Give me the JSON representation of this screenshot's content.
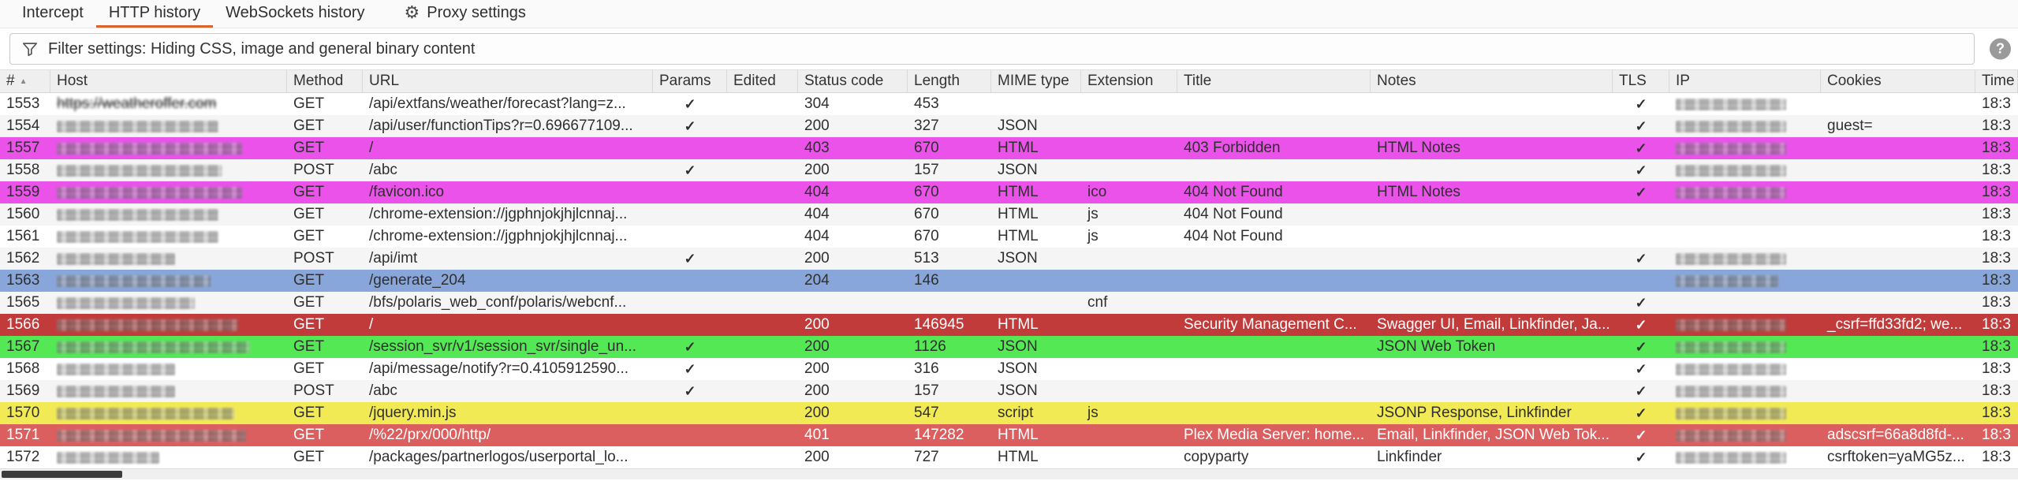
{
  "tabs": {
    "items": [
      {
        "label": "Intercept"
      },
      {
        "label": "HTTP history",
        "active": true
      },
      {
        "label": "WebSockets history"
      },
      {
        "label": "Proxy settings",
        "icon": "gear-icon"
      }
    ]
  },
  "filter_bar": {
    "icon": "filter-funnel-icon",
    "text": "Filter settings: Hiding CSS, image and general binary content",
    "help_icon": "?"
  },
  "glyphs": {
    "check": "✓",
    "sort_ascending": "▲",
    "gear": "⚙"
  },
  "colors": {
    "accent_orange": "#d9632d",
    "magenta": "#ea52ea",
    "blue": "#88a6d9",
    "green": "#55e855",
    "yellow": "#f2ea55",
    "red_dark": "#c23b3b",
    "red_light": "#dc5f5f"
  },
  "table": {
    "columns": [
      "#",
      "Host",
      "Method",
      "URL",
      "Params",
      "Edited",
      "Status code",
      "Length",
      "MIME type",
      "Extension",
      "Title",
      "Notes",
      "TLS",
      "IP",
      "Cookies",
      "Time"
    ],
    "rows": [
      {
        "id": "1553",
        "host_text": "https://weatheroffer.com",
        "host_w": 0,
        "method": "GET",
        "url": "/api/extfans/weather/forecast?lang=z...",
        "params": true,
        "edited": false,
        "status": "304",
        "length": "453",
        "mime": "",
        "ext": "",
        "title": "",
        "notes": "",
        "tls": true,
        "ip_w": 140,
        "cookies": "",
        "time": "18:3",
        "highlight": ""
      },
      {
        "id": "1554",
        "host_w": 205,
        "method": "GET",
        "url": "/api/user/functionTips?r=0.696677109...",
        "params": true,
        "edited": false,
        "status": "200",
        "length": "327",
        "mime": "JSON",
        "ext": "",
        "title": "",
        "notes": "",
        "tls": true,
        "ip_w": 140,
        "cookies": "guest=",
        "time": "18:3",
        "highlight": ""
      },
      {
        "id": "1557",
        "host_w": 235,
        "method": "GET",
        "url": "/",
        "params": false,
        "edited": false,
        "status": "403",
        "length": "670",
        "mime": "HTML",
        "ext": "",
        "title": "403 Forbidden",
        "notes": "HTML Notes",
        "tls": true,
        "ip_w": 140,
        "cookies": "",
        "time": "18:3",
        "highlight": "magenta"
      },
      {
        "id": "1558",
        "host_w": 210,
        "method": "POST",
        "url": "/abc",
        "params": true,
        "edited": false,
        "status": "200",
        "length": "157",
        "mime": "JSON",
        "ext": "",
        "title": "",
        "notes": "",
        "tls": true,
        "ip_w": 140,
        "cookies": "",
        "time": "18:3",
        "highlight": ""
      },
      {
        "id": "1559",
        "host_w": 235,
        "method": "GET",
        "url": "/favicon.ico",
        "params": false,
        "edited": false,
        "status": "404",
        "length": "670",
        "mime": "HTML",
        "ext": "ico",
        "title": "404 Not Found",
        "notes": "HTML Notes",
        "tls": true,
        "ip_w": 140,
        "cookies": "",
        "time": "18:3",
        "highlight": "magenta"
      },
      {
        "id": "1560",
        "host_w": 205,
        "method": "GET",
        "url": "/chrome-extension://jgphnjokjhjlcnnaj...",
        "params": false,
        "edited": false,
        "status": "404",
        "length": "670",
        "mime": "HTML",
        "ext": "js",
        "title": "404 Not Found",
        "notes": "",
        "tls": false,
        "ip_w": 0,
        "cookies": "",
        "time": "18:3",
        "highlight": ""
      },
      {
        "id": "1561",
        "host_w": 205,
        "method": "GET",
        "url": "/chrome-extension://jgphnjokjhjlcnnaj...",
        "params": false,
        "edited": false,
        "status": "404",
        "length": "670",
        "mime": "HTML",
        "ext": "js",
        "title": "404 Not Found",
        "notes": "",
        "tls": false,
        "ip_w": 0,
        "cookies": "",
        "time": "18:3",
        "highlight": ""
      },
      {
        "id": "1562",
        "host_w": 150,
        "method": "POST",
        "url": "/api/imt",
        "params": true,
        "edited": false,
        "status": "200",
        "length": "513",
        "mime": "JSON",
        "ext": "",
        "title": "",
        "notes": "",
        "tls": true,
        "ip_w": 140,
        "cookies": "",
        "time": "18:3",
        "highlight": ""
      },
      {
        "id": "1563",
        "host_w": 195,
        "method": "GET",
        "url": "/generate_204",
        "params": false,
        "edited": false,
        "status": "204",
        "length": "146",
        "mime": "",
        "ext": "",
        "title": "",
        "notes": "",
        "tls": false,
        "ip_w": 130,
        "cookies": "",
        "time": "18:3",
        "highlight": "blue"
      },
      {
        "id": "1565",
        "host_w": 175,
        "method": "GET",
        "url": "/bfs/polaris_web_conf/polaris/webcnf...",
        "params": false,
        "edited": false,
        "status": "",
        "length": "",
        "mime": "",
        "ext": "cnf",
        "title": "",
        "notes": "",
        "tls": true,
        "ip_w": 0,
        "cookies": "",
        "time": "18:3",
        "highlight": ""
      },
      {
        "id": "1566",
        "host_w": 230,
        "method": "GET",
        "url": "/",
        "params": false,
        "edited": false,
        "status": "200",
        "length": "146945",
        "mime": "HTML",
        "ext": "",
        "title": "Security Management C...",
        "notes": "Swagger UI, Email, Linkfinder, Ja...",
        "tls": true,
        "ip_w": 140,
        "cookies": "_csrf=ffd33fd2; we...",
        "time": "18:3",
        "highlight": "red_dark",
        "text": "light"
      },
      {
        "id": "1567",
        "host_w": 245,
        "method": "GET",
        "url": "/session_svr/v1/session_svr/single_un...",
        "params": true,
        "edited": false,
        "status": "200",
        "length": "1126",
        "mime": "JSON",
        "ext": "",
        "title": "",
        "notes": "JSON Web Token",
        "tls": true,
        "ip_w": 140,
        "cookies": "",
        "time": "18:3",
        "highlight": "green"
      },
      {
        "id": "1568",
        "host_w": 150,
        "method": "GET",
        "url": "/api/message/notify?r=0.4105912590...",
        "params": true,
        "edited": false,
        "status": "200",
        "length": "316",
        "mime": "JSON",
        "ext": "",
        "title": "",
        "notes": "",
        "tls": true,
        "ip_w": 140,
        "cookies": "",
        "time": "18:3",
        "highlight": ""
      },
      {
        "id": "1569",
        "host_w": 150,
        "method": "POST",
        "url": "/abc",
        "params": true,
        "edited": false,
        "status": "200",
        "length": "157",
        "mime": "JSON",
        "ext": "",
        "title": "",
        "notes": "",
        "tls": true,
        "ip_w": 140,
        "cookies": "",
        "time": "18:3",
        "highlight": ""
      },
      {
        "id": "1570",
        "host_w": 225,
        "method": "GET",
        "url": "/jquery.min.js",
        "params": false,
        "edited": false,
        "status": "200",
        "length": "547",
        "mime": "script",
        "ext": "js",
        "title": "",
        "notes": "JSONP Response, Linkfinder",
        "tls": true,
        "ip_w": 140,
        "cookies": "",
        "time": "18:3",
        "highlight": "yellow"
      },
      {
        "id": "1571",
        "host_w": 240,
        "method": "GET",
        "url": "/%22/prx/000/http/",
        "params": false,
        "edited": false,
        "status": "401",
        "length": "147282",
        "mime": "HTML",
        "ext": "",
        "title": "Plex Media Server: home...",
        "notes": "Email, Linkfinder, JSON Web Tok...",
        "tls": true,
        "ip_w": 140,
        "cookies": "adscsrf=66a8d8fd-...",
        "time": "18:3",
        "highlight": "red_light",
        "text": "light"
      },
      {
        "id": "1572",
        "host_w": 130,
        "method": "GET",
        "url": "/packages/partnerlogos/userportal_lo...",
        "params": false,
        "edited": false,
        "status": "200",
        "length": "727",
        "mime": "HTML",
        "ext": "",
        "title": "copyparty",
        "notes": "Linkfinder",
        "tls": true,
        "ip_w": 140,
        "cookies": "csrftoken=yaMG5z...",
        "time": "18:3",
        "highlight": ""
      }
    ]
  }
}
